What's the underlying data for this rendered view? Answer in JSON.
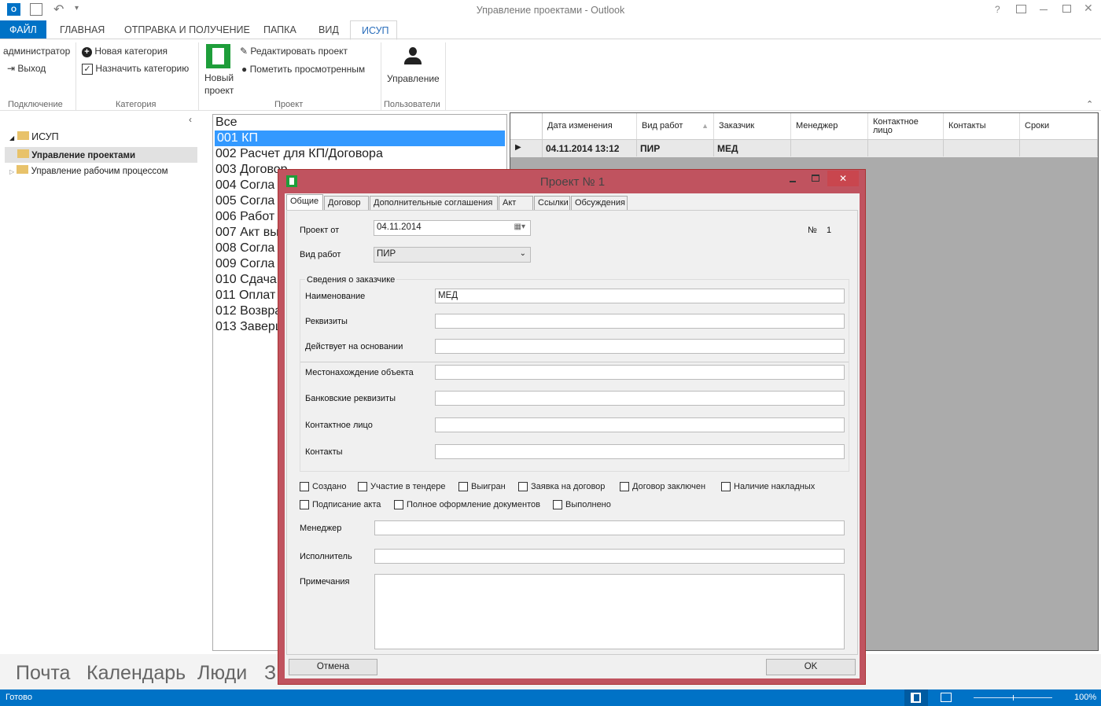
{
  "window": {
    "title": "Управление проектами - Outlook",
    "help": "?"
  },
  "ribbon": {
    "tabs": [
      "ФАЙЛ",
      "ГЛАВНАЯ",
      "ОТПРАВКА И ПОЛУЧЕНИЕ",
      "ПАПКА",
      "ВИД",
      "ИСУП"
    ],
    "active_tab": "ИСУП",
    "user": "администратор",
    "logout": "Выход",
    "new_category": "Новая категория",
    "assign_category": "Назначить категорию",
    "new_project_line1": "Новый",
    "new_project_line2": "проект",
    "edit_project": "Редактировать проект",
    "mark_viewed": "Пометить просмотренным",
    "manage": "Управление",
    "groups": [
      "Подключение",
      "Категория",
      "Проект",
      "Пользователи"
    ]
  },
  "folders": {
    "root": "ИСУП",
    "items": [
      "Управление проектами",
      "Управление рабочим процессом"
    ],
    "selected": "Управление проектами"
  },
  "categories": [
    "Все",
    "001 КП",
    "002 Расчет для КП/Договора",
    "003 Договор",
    "004 Согла",
    "005 Согла",
    "006 Работ",
    "007 Акт вы",
    "008 Согла",
    "009 Согла",
    "010 Сдача",
    "011 Оплат",
    "012 Возвра",
    "013 Заверш"
  ],
  "grid": {
    "columns": [
      "Дата изменения",
      "Вид работ",
      "Заказчик",
      "Менеджер",
      "Контактное лицо",
      "Контакты",
      "Сроки"
    ],
    "rows": [
      [
        "04.11.2014 13:12",
        "ПИР",
        "МЕД",
        "",
        "",
        "",
        ""
      ]
    ]
  },
  "nav": {
    "items": [
      "Почта",
      "Календарь",
      "Люди",
      "З"
    ]
  },
  "status": {
    "text": "Готово",
    "zoom": "100%"
  },
  "dialog": {
    "title": "Проект № 1",
    "tabs": [
      "Общие",
      "Договор",
      "Дополнительные соглашения",
      "Акт",
      "Ссылки",
      "Обсуждения"
    ],
    "active_tab": "Общие",
    "project_date_label": "Проект от",
    "project_date": "04.11.2014",
    "number_label": "№",
    "number": "1",
    "work_type_label": "Вид работ",
    "work_type": "ПИР",
    "customer_group": "Сведения о заказчике",
    "customer_fields": [
      {
        "label": "Наименование",
        "value": "МЕД"
      },
      {
        "label": "Реквизиты",
        "value": ""
      },
      {
        "label": "Действует на основании",
        "value": ""
      },
      {
        "label": "Местонахождение объекта",
        "value": ""
      },
      {
        "label": "Банковские реквизиты",
        "value": ""
      },
      {
        "label": "Контактное лицо",
        "value": ""
      },
      {
        "label": "Контакты",
        "value": ""
      }
    ],
    "checkboxes": [
      {
        "label": "Создано",
        "checked": false
      },
      {
        "label": "Участие в тендере",
        "checked": false
      },
      {
        "label": "Выигран",
        "checked": false
      },
      {
        "label": "Заявка на договор",
        "checked": false
      },
      {
        "label": "Договор заключен",
        "checked": false
      },
      {
        "label": "Наличие накладных",
        "checked": false
      },
      {
        "label": "Подписание акта",
        "checked": false
      },
      {
        "label": "Полное оформление документов",
        "checked": false
      },
      {
        "label": "Выполнено",
        "checked": false
      }
    ],
    "manager_label": "Менеджер",
    "manager": "",
    "executor_label": "Исполнитель",
    "executor": "",
    "notes_label": "Примечания",
    "notes": "",
    "cancel": "Отмена",
    "ok": "OK"
  },
  "colors": {
    "accent": "#0072c6",
    "dialog_border": "#c0535f",
    "grid_bg": "#ababab",
    "selection": "#3399ff"
  }
}
